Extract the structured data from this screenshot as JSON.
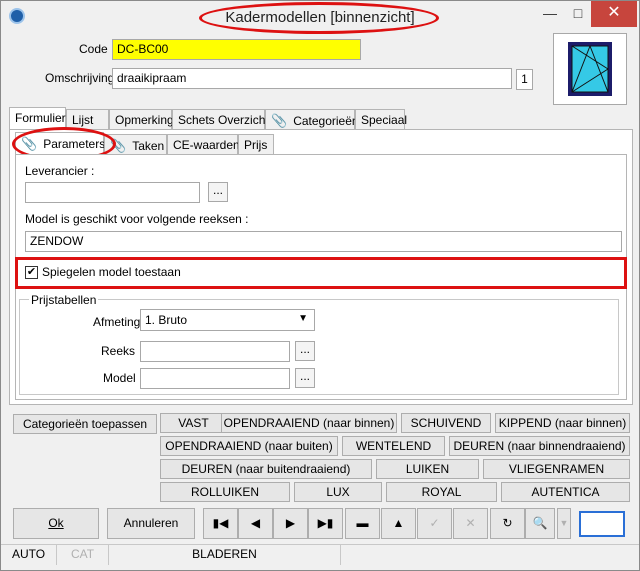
{
  "window": {
    "title": "Kadermodellen [binnenzicht]"
  },
  "form": {
    "code_label": "Code :",
    "code_value": "DC-BC00",
    "desc_label": "Omschrijving :",
    "desc_value": "draaikipraam",
    "desc_count": "1"
  },
  "tabs_main": [
    "Formulier",
    "Lijst",
    "Opmerking",
    "Schets Overzicht",
    "Categorieën",
    "Speciaal"
  ],
  "tabs_sub": [
    "Parameters",
    "Taken",
    "CE-waarden",
    "Prijs"
  ],
  "parameters": {
    "leverancier_label": "Leverancier :",
    "leverancier_value": "",
    "ellipsis": "...",
    "reeksen_label": "Model is geschikt voor volgende reeksen :",
    "reeksen_value": "ZENDOW",
    "spiegelen_label": "Spiegelen model toestaan",
    "spiegelen_checked": true
  },
  "prijstabellen": {
    "title": "Prijstabellen",
    "afmeting_label": "Afmeting",
    "afmeting_value": "1.  Bruto",
    "reeks_label": "Reeks",
    "reeks_value": "",
    "model_label": "Model",
    "model_value": ""
  },
  "categories": {
    "apply_label": "Categorieën toepassen",
    "row1": [
      "VAST",
      "OPENDRAAIEND (naar binnen)",
      "SCHUIVEND",
      "KIPPEND (naar binnen)"
    ],
    "row2": [
      "OPENDRAAIEND (naar buiten)",
      "WENTELEND",
      "DEUREN (naar binnendraaiend)"
    ],
    "row3": [
      "DEUREN (naar buitendraaiend)",
      "LUIKEN",
      "VLIEGENRAMEN"
    ],
    "row4": [
      "ROLLUIKEN",
      "LUX",
      "ROYAL",
      "AUTENTICA"
    ]
  },
  "footer": {
    "ok_label": "Ok",
    "cancel_label": "Annuleren"
  },
  "status": {
    "auto": "AUTO",
    "cat": "CAT",
    "mode": "BLADEREN"
  },
  "colors": {
    "code_bg": "#ffff00",
    "annotation": "#dd1111"
  }
}
